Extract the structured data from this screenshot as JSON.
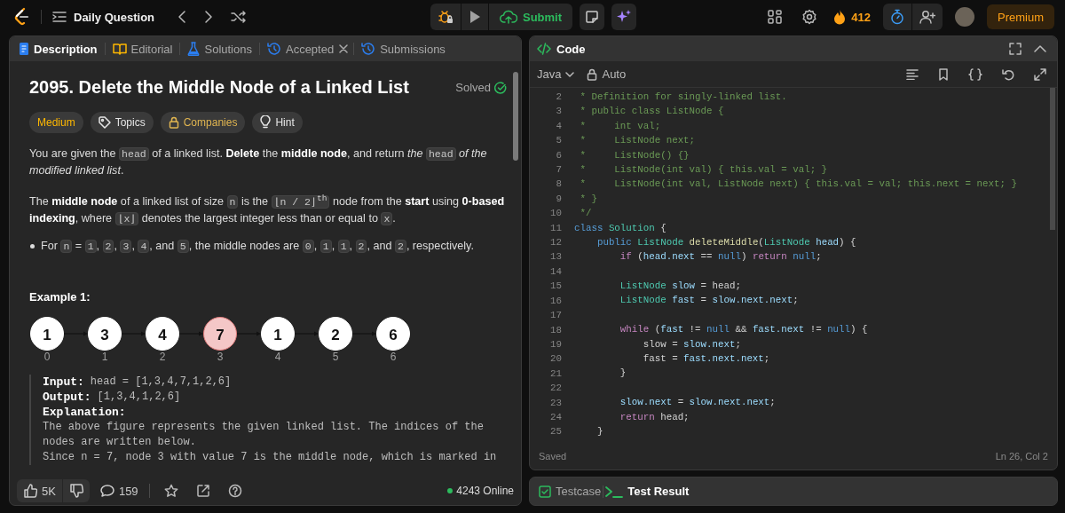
{
  "nav": {
    "title": "Daily Question",
    "submit": "Submit",
    "streak": "412",
    "premium": "Premium"
  },
  "description_panel": {
    "tabs": [
      {
        "kind": "description",
        "label": "Description",
        "selected": true,
        "closable": false
      },
      {
        "kind": "editorial",
        "label": "Editorial",
        "selected": false,
        "closable": false
      },
      {
        "kind": "solutions",
        "label": "Solutions",
        "selected": false,
        "closable": false
      },
      {
        "kind": "accepted",
        "label": "Accepted",
        "selected": false,
        "closable": true
      },
      {
        "kind": "submissions",
        "label": "Submissions",
        "selected": false,
        "closable": false
      }
    ],
    "title": "2095. Delete the Middle Node of a Linked List",
    "status": "Solved",
    "solved": true,
    "tags": [
      {
        "kind": "difficulty",
        "label": "Medium"
      },
      {
        "kind": "topics",
        "label": "Topics"
      },
      {
        "kind": "companies",
        "label": "Companies"
      },
      {
        "kind": "hint",
        "label": "Hint"
      }
    ],
    "paragraphs": [
      {
        "kind": "text",
        "segments": [
          {
            "kind": "text",
            "text": "You are given the "
          },
          {
            "kind": "code",
            "text": "head"
          },
          {
            "kind": "text",
            "text": " of a linked list. **Delete** the **middle node**, and return *the* "
          },
          {
            "kind": "code",
            "text": "head"
          },
          {
            "kind": "text",
            "text": " *of the modified linked list*."
          }
        ]
      },
      {
        "kind": "text",
        "segments": [
          {
            "kind": "text",
            "text": "The **middle node** of a linked list of size "
          },
          {
            "kind": "code",
            "text": "n"
          },
          {
            "kind": "text",
            "text": " is the "
          },
          {
            "kind": "code",
            "text": "⌊n / 2⌋$^{th}$"
          },
          {
            "kind": "text",
            "text": " node from the **start** using **0-based indexing**, where "
          },
          {
            "kind": "code",
            "text": "⌊x⌋"
          },
          {
            "kind": "text",
            "text": " denotes the largest integer less than or equal to "
          },
          {
            "kind": "code",
            "text": "x"
          },
          {
            "kind": "text",
            "text": "."
          }
        ]
      },
      {
        "kind": "bullet",
        "segments": [
          {
            "kind": "text",
            "text": "For "
          },
          {
            "kind": "code",
            "text": "n"
          },
          {
            "kind": "text",
            "text": " = "
          },
          {
            "kind": "code",
            "text": "1"
          },
          {
            "kind": "text",
            "text": ", "
          },
          {
            "kind": "code",
            "text": "2"
          },
          {
            "kind": "text",
            "text": ", "
          },
          {
            "kind": "code",
            "text": "3"
          },
          {
            "kind": "text",
            "text": ", "
          },
          {
            "kind": "code",
            "text": "4"
          },
          {
            "kind": "text",
            "text": ", and "
          },
          {
            "kind": "code",
            "text": "5"
          },
          {
            "kind": "text",
            "text": ", the middle nodes are "
          },
          {
            "kind": "code",
            "text": "0"
          },
          {
            "kind": "text",
            "text": ", "
          },
          {
            "kind": "code",
            "text": "1"
          },
          {
            "kind": "text",
            "text": ", "
          },
          {
            "kind": "code",
            "text": "1"
          },
          {
            "kind": "text",
            "text": ", "
          },
          {
            "kind": "code",
            "text": "2"
          },
          {
            "kind": "text",
            "text": ", and "
          },
          {
            "kind": "code",
            "text": "2"
          },
          {
            "kind": "text",
            "text": ", respectively."
          }
        ]
      }
    ],
    "example": {
      "heading": "Example 1:",
      "nodes": [
        {
          "value": "1",
          "index": "0",
          "highlighted": false
        },
        {
          "value": "3",
          "index": "1",
          "highlighted": false
        },
        {
          "value": "4",
          "index": "2",
          "highlighted": false
        },
        {
          "value": "7",
          "index": "3",
          "highlighted": true
        },
        {
          "value": "1",
          "index": "4",
          "highlighted": false
        },
        {
          "value": "2",
          "index": "5",
          "highlighted": false
        },
        {
          "value": "6",
          "index": "6",
          "highlighted": false
        }
      ],
      "lines": [
        {
          "label": "Input:",
          "value": "head = [1,3,4,7,1,2,6]"
        },
        {
          "label": "Output:",
          "value": "[1,3,4,1,2,6]"
        },
        {
          "label": "Explanation:"
        }
      ],
      "explanation": [
        "The above figure represents the given linked list. The indices of the nodes are written below.",
        "Since n = 7, node 3 with value 7 is the middle node, which is marked in"
      ]
    },
    "footer": {
      "likes": "5K",
      "comments": "159",
      "online": "4243 Online"
    }
  },
  "code_panel": {
    "title": "Code",
    "language": "Java",
    "mode": "Auto",
    "lines": [
      {
        "number": "2",
        "tokens": [
          {
            "kind": "comment",
            "text": " * Definition for singly-linked list."
          }
        ]
      },
      {
        "number": "3",
        "tokens": [
          {
            "kind": "comment",
            "text": " * public class ListNode {"
          }
        ]
      },
      {
        "number": "4",
        "tokens": [
          {
            "kind": "comment",
            "text": " *     int val;"
          }
        ]
      },
      {
        "number": "5",
        "tokens": [
          {
            "kind": "comment",
            "text": " *     ListNode next;"
          }
        ]
      },
      {
        "number": "6",
        "tokens": [
          {
            "kind": "comment",
            "text": " *     ListNode() {}"
          }
        ]
      },
      {
        "number": "7",
        "tokens": [
          {
            "kind": "comment",
            "text": " *     ListNode(int val) { this.val = val; }"
          }
        ]
      },
      {
        "number": "8",
        "tokens": [
          {
            "kind": "comment",
            "text": " *     ListNode(int val, ListNode next) { this.val = val; this.next = next; }"
          }
        ]
      },
      {
        "number": "9",
        "tokens": [
          {
            "kind": "comment",
            "text": " * }"
          }
        ]
      },
      {
        "number": "10",
        "tokens": [
          {
            "kind": "comment",
            "text": " */"
          }
        ]
      },
      {
        "number": "11",
        "tokens": [
          {
            "kind": "keyword",
            "text": "class"
          },
          {
            "kind": "type",
            "text": " Solution"
          },
          {
            "kind": "plain",
            "text": " {"
          }
        ]
      },
      {
        "number": "12",
        "tokens": [
          {
            "kind": "keyword",
            "text": "    public"
          },
          {
            "kind": "type",
            "text": " ListNode"
          },
          {
            "kind": "function",
            "text": " deleteMiddle"
          },
          {
            "kind": "plain",
            "text": "("
          },
          {
            "kind": "type",
            "text": "ListNode"
          },
          {
            "kind": "variable",
            "text": " head"
          },
          {
            "kind": "plain",
            "text": ") {"
          }
        ]
      },
      {
        "number": "13",
        "tokens": [
          {
            "kind": "control",
            "text": "        if"
          },
          {
            "kind": "plain",
            "text": " ("
          },
          {
            "kind": "variable",
            "text": "head.next"
          },
          {
            "kind": "plain",
            "text": " == "
          },
          {
            "kind": "keyword",
            "text": "null"
          },
          {
            "kind": "plain",
            "text": ") "
          },
          {
            "kind": "control",
            "text": "return"
          },
          {
            "kind": "keyword",
            "text": " null"
          },
          {
            "kind": "plain",
            "text": ";"
          }
        ]
      },
      {
        "number": "14"
      },
      {
        "number": "15",
        "tokens": [
          {
            "kind": "type",
            "text": "        ListNode"
          },
          {
            "kind": "variable",
            "text": " slow"
          },
          {
            "kind": "plain",
            "text": " = head;"
          }
        ]
      },
      {
        "number": "16",
        "tokens": [
          {
            "kind": "type",
            "text": "        ListNode"
          },
          {
            "kind": "variable",
            "text": " fast"
          },
          {
            "kind": "plain",
            "text": " = "
          },
          {
            "kind": "variable",
            "text": "slow.next.next"
          },
          {
            "kind": "plain",
            "text": ";"
          }
        ]
      },
      {
        "number": "17"
      },
      {
        "number": "18",
        "tokens": [
          {
            "kind": "control",
            "text": "        while"
          },
          {
            "kind": "plain",
            "text": " ("
          },
          {
            "kind": "variable",
            "text": "fast"
          },
          {
            "kind": "plain",
            "text": " != "
          },
          {
            "kind": "keyword",
            "text": "null"
          },
          {
            "kind": "plain",
            "text": " && "
          },
          {
            "kind": "variable",
            "text": "fast.next"
          },
          {
            "kind": "plain",
            "text": " != "
          },
          {
            "kind": "keyword",
            "text": "null"
          },
          {
            "kind": "plain",
            "text": ") {"
          }
        ]
      },
      {
        "number": "19",
        "tokens": [
          {
            "kind": "plain",
            "text": "            slow = "
          },
          {
            "kind": "variable",
            "text": "slow.next"
          },
          {
            "kind": "plain",
            "text": ";"
          }
        ]
      },
      {
        "number": "20",
        "tokens": [
          {
            "kind": "plain",
            "text": "            fast = "
          },
          {
            "kind": "variable",
            "text": "fast.next.next"
          },
          {
            "kind": "plain",
            "text": ";"
          }
        ]
      },
      {
        "number": "21",
        "tokens": [
          {
            "kind": "plain",
            "text": "        }"
          }
        ]
      },
      {
        "number": "22"
      },
      {
        "number": "23",
        "tokens": [
          {
            "kind": "variable",
            "text": "        slow.next"
          },
          {
            "kind": "plain",
            "text": " = "
          },
          {
            "kind": "variable",
            "text": "slow.next.next"
          },
          {
            "kind": "plain",
            "text": ";"
          }
        ]
      },
      {
        "number": "24",
        "tokens": [
          {
            "kind": "control",
            "text": "        return"
          },
          {
            "kind": "plain",
            "text": " head;"
          }
        ]
      },
      {
        "number": "25",
        "tokens": [
          {
            "kind": "plain",
            "text": "    }"
          }
        ]
      }
    ],
    "save_status": "Saved",
    "cursor": "Ln 26, Col 2"
  },
  "console_panel": {
    "tabs": [
      {
        "kind": "testcase",
        "label": "Testcase",
        "selected": false
      },
      {
        "kind": "result",
        "label": "Test Result",
        "selected": true
      }
    ]
  }
}
